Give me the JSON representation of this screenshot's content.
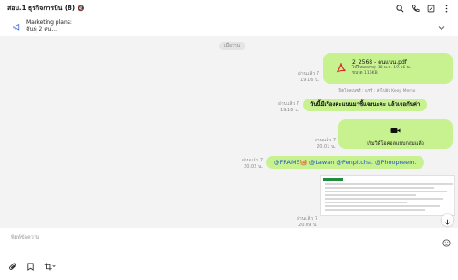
{
  "header": {
    "title": "สอบ.1 ธุรกิจการบิน (8)",
    "mute_icon": "mute-icon"
  },
  "announcement": {
    "title": "Marketing plans:",
    "subtitle": "จันทุ์ 2 คน..."
  },
  "chat": {
    "date_divider": "เมื่อวาน",
    "messages": [
      {
        "type": "file",
        "read": "อ่านแล้ว 7",
        "time": "19.16 น.",
        "file_name": "2_2568 - คนแนน.pdf",
        "file_detail_1": "ไฟล์หมดอายุ: 18 ม.ค. 19.16 น.",
        "file_detail_2": "ขนาด 116KB",
        "note": "เปิดไฟลเนซร์ : แชร์ : ส่งไปยัง Keep Memo"
      },
      {
        "type": "text",
        "read": "อ่านแล้ว 7",
        "time": "19.16 น.",
        "text": "วันนี้มีเรื่องคะแนนมาชี้แจงนะคะ แล้วเจอกันค่า"
      },
      {
        "type": "call",
        "read": "อ่านแล้ว 7",
        "time": "20.01 น.",
        "text": "เริ่มวิดีโอคอลแบบกลุ่มแล้ว"
      },
      {
        "type": "mention",
        "read": "อ่านแล้ว 7",
        "time": "20.02 น.",
        "text": "@FRAME🧺 @Lawan @Penpitcha. @Phoopreem."
      },
      {
        "type": "image",
        "read": "อ่านแล้ว 7",
        "time": "20.09 น."
      }
    ]
  },
  "input": {
    "placeholder": "พิมพ์ข้อความ"
  },
  "colors": {
    "bubble": "#c8f28f",
    "mention": "#1a56c8",
    "pdf": "#e0262f"
  }
}
